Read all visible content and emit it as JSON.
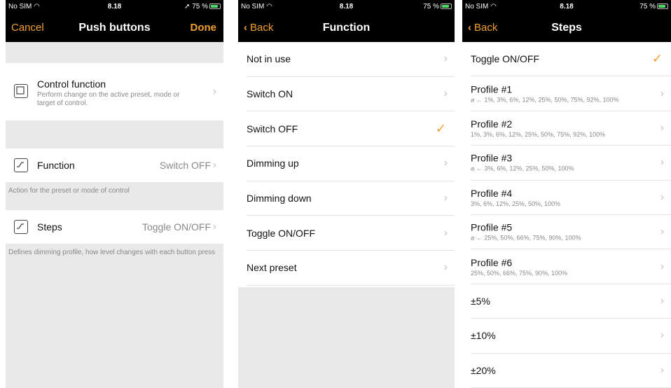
{
  "screen1": {
    "status": {
      "carrier": "No SIM",
      "time": "8.18",
      "battery": "75 %"
    },
    "nav": {
      "cancel": "Cancel",
      "title": "Push buttons",
      "done": "Done"
    },
    "control": {
      "title": "Control function",
      "subtitle": "Perform change on the active preset, mode or target of control."
    },
    "function": {
      "label": "Function",
      "value": "Switch OFF"
    },
    "function_note": "Action for the preset or mode of control",
    "steps": {
      "label": "Steps",
      "value": "Toggle ON/OFF"
    },
    "steps_note": "Defines dimming profile, how level changes with each button press"
  },
  "screen2": {
    "status": {
      "carrier": "No SIM",
      "time": "8.18",
      "battery": "75 %"
    },
    "nav": {
      "back": "Back",
      "title": "Function"
    },
    "items": [
      {
        "label": "Not in use"
      },
      {
        "label": "Switch ON"
      },
      {
        "label": "Switch OFF",
        "checked": true
      },
      {
        "label": "Dimming up"
      },
      {
        "label": "Dimming down"
      },
      {
        "label": "Toggle ON/OFF"
      },
      {
        "label": "Next preset"
      }
    ]
  },
  "screen3": {
    "status": {
      "carrier": "No SIM",
      "time": "8.18",
      "battery": "75 %"
    },
    "nav": {
      "back": "Back",
      "title": "Steps"
    },
    "items": [
      {
        "label": "Toggle ON/OFF",
        "sub": "",
        "checked": true
      },
      {
        "label": "Profile #1",
        "sub": "⌀ ← 1%, 3%, 6%, 12%, 25%, 50%, 75%, 92%, 100%"
      },
      {
        "label": "Profile #2",
        "sub": "1%, 3%, 6%, 12%, 25%, 50%, 75%, 92%, 100%"
      },
      {
        "label": "Profile #3",
        "sub": "⌀ ← 3%, 6%, 12%, 25%, 50%, 100%"
      },
      {
        "label": "Profile #4",
        "sub": "3%, 6%, 12%, 25%, 50%, 100%"
      },
      {
        "label": "Profile #5",
        "sub": "⌀ ← 25%, 50%, 66%, 75%, 90%, 100%"
      },
      {
        "label": "Profile #6",
        "sub": "25%, 50%, 66%, 75%, 90%, 100%"
      },
      {
        "label": "±5%",
        "sub": ""
      },
      {
        "label": "±10%",
        "sub": ""
      },
      {
        "label": "±20%",
        "sub": ""
      }
    ]
  },
  "colors": {
    "accent": "#f0a030",
    "background": "#e9e9e9",
    "bar": "#000000"
  }
}
